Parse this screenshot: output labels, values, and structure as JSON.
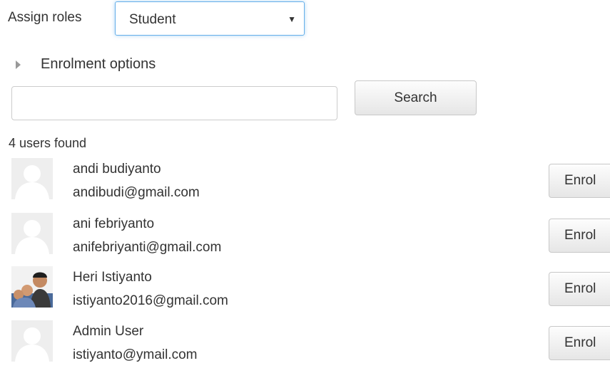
{
  "assign": {
    "label": "Assign roles",
    "selected_role": "Student"
  },
  "enrolment_options": {
    "label": "Enrolment options"
  },
  "search": {
    "placeholder": "",
    "button_label": "Search"
  },
  "results": {
    "count_text": "4 users found",
    "users": [
      {
        "name": "andi budiyanto",
        "email": "andibudi@gmail.com",
        "avatar": "default-user-icon",
        "action": "Enrol"
      },
      {
        "name": "ani febriyanto",
        "email": "anifebriyanti@gmail.com",
        "avatar": "default-user-icon",
        "action": "Enrol"
      },
      {
        "name": "Heri Istiyanto",
        "email": "istiyanto2016@gmail.com",
        "avatar": "user-photo",
        "action": "Enrol"
      },
      {
        "name": "Admin User",
        "email": "istiyanto@ymail.com",
        "avatar": "default-user-icon",
        "action": "Enrol"
      }
    ]
  },
  "colors": {
    "focus_border": "#66afe9",
    "text": "#333333",
    "avatar_bg": "#eeeeee"
  }
}
